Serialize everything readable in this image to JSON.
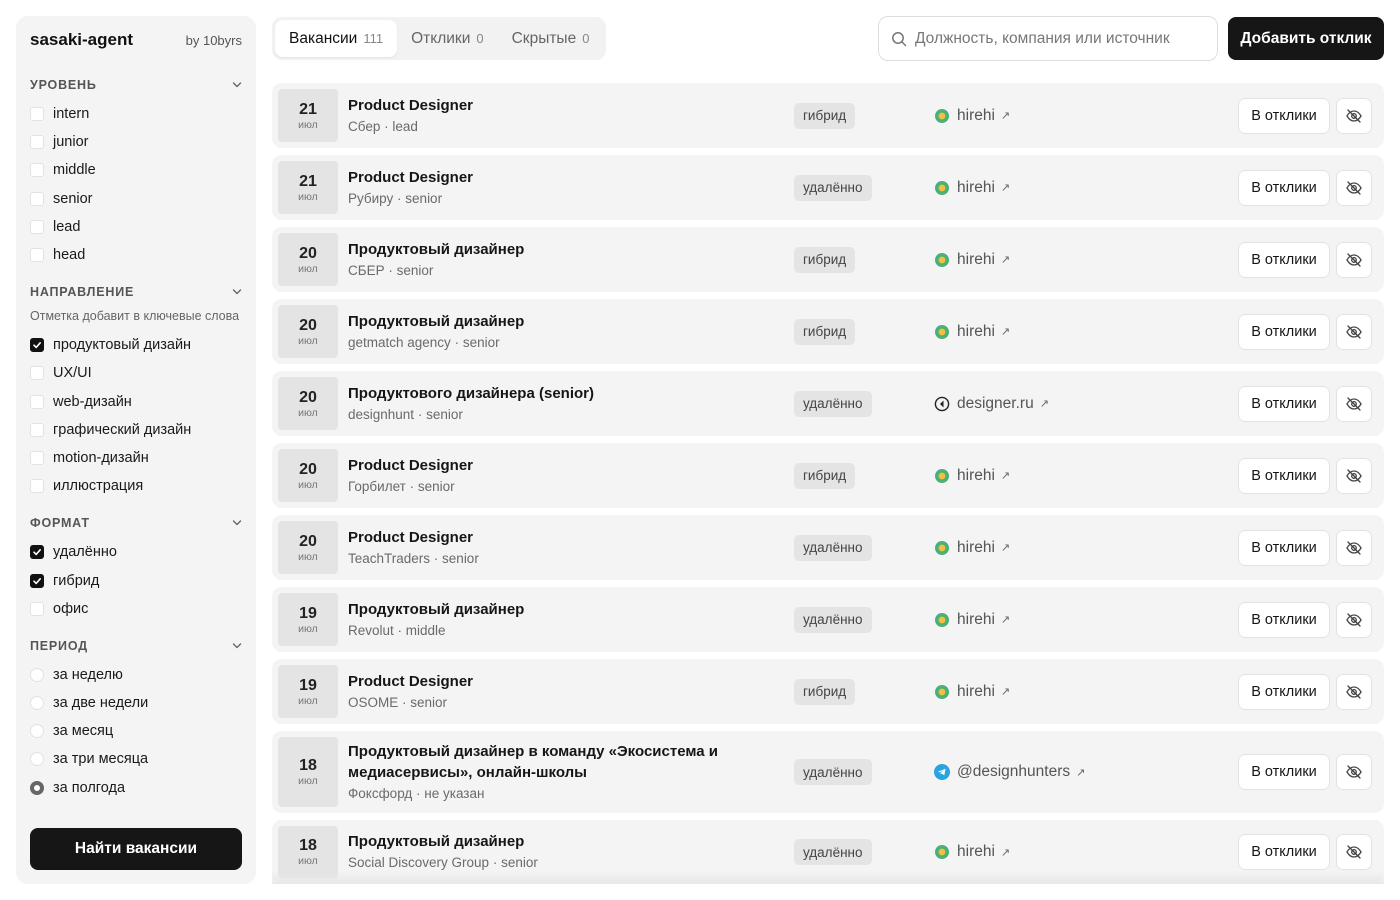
{
  "sidebar": {
    "brand": "sasaki-agent",
    "by": "by 10byrs",
    "level": {
      "title": "УРОВЕНЬ",
      "options": [
        {
          "label": "intern",
          "checked": false
        },
        {
          "label": "junior",
          "checked": false
        },
        {
          "label": "middle",
          "checked": false
        },
        {
          "label": "senior",
          "checked": false
        },
        {
          "label": "lead",
          "checked": false
        },
        {
          "label": "head",
          "checked": false
        }
      ]
    },
    "direction": {
      "title": "НАПРАВЛЕНИЕ",
      "hint": "Отметка добавит в ключевые слова",
      "options": [
        {
          "label": "продуктовый дизайн",
          "checked": true
        },
        {
          "label": "UX/UI",
          "checked": false
        },
        {
          "label": "web-дизайн",
          "checked": false
        },
        {
          "label": "графический дизайн",
          "checked": false
        },
        {
          "label": "motion-дизайн",
          "checked": false
        },
        {
          "label": "иллюстрация",
          "checked": false
        }
      ]
    },
    "format": {
      "title": "ФОРМАТ",
      "options": [
        {
          "label": "удалённо",
          "checked": true
        },
        {
          "label": "гибрид",
          "checked": true
        },
        {
          "label": "офис",
          "checked": false
        }
      ]
    },
    "period": {
      "title": "ПЕРИОД",
      "options": [
        {
          "label": "за неделю",
          "selected": false
        },
        {
          "label": "за две недели",
          "selected": false
        },
        {
          "label": "за месяц",
          "selected": false
        },
        {
          "label": "за три месяца",
          "selected": false
        },
        {
          "label": "за полгода",
          "selected": true
        }
      ]
    },
    "find_button": "Найти вакансии"
  },
  "tabs": [
    {
      "label": "Вакансии",
      "count": "111",
      "active": true
    },
    {
      "label": "Отклики",
      "count": "0",
      "active": false
    },
    {
      "label": "Скрытые",
      "count": "0",
      "active": false
    }
  ],
  "search": {
    "placeholder": "Должность, компания или источник",
    "value": ""
  },
  "add_button": "Добавить отклик",
  "respond_label": "В отклики",
  "vacancies": [
    {
      "day": "21",
      "month": "июл",
      "title": "Product Designer",
      "company": "Сбер",
      "level": "lead",
      "format": "гибрид",
      "source": "hirehi",
      "source_icon": "hirehi-icon"
    },
    {
      "day": "21",
      "month": "июл",
      "title": "Product Designer",
      "company": "Рубиру",
      "level": "senior",
      "format": "удалённо",
      "source": "hirehi",
      "source_icon": "hirehi-icon"
    },
    {
      "day": "20",
      "month": "июл",
      "title": "Продуктовый дизайнер",
      "company": "СБЕР",
      "level": "senior",
      "format": "гибрид",
      "source": "hirehi",
      "source_icon": "hirehi-icon"
    },
    {
      "day": "20",
      "month": "июл",
      "title": "Продуктовый дизайнер",
      "company": "getmatch agency",
      "level": "senior",
      "format": "гибрид",
      "source": "hirehi",
      "source_icon": "hirehi-icon"
    },
    {
      "day": "20",
      "month": "июл",
      "title": "Продуктового дизайнера (senior)",
      "company": "designhunt",
      "level": "senior",
      "format": "удалённо",
      "source": "designer.ru",
      "source_icon": "designer-ru-icon"
    },
    {
      "day": "20",
      "month": "июл",
      "title": "Product Designer",
      "company": "Горбилет",
      "level": "senior",
      "format": "гибрид",
      "source": "hirehi",
      "source_icon": "hirehi-icon"
    },
    {
      "day": "20",
      "month": "июл",
      "title": "Product Designer",
      "company": "TeachTraders",
      "level": "senior",
      "format": "удалённо",
      "source": "hirehi",
      "source_icon": "hirehi-icon"
    },
    {
      "day": "19",
      "month": "июл",
      "title": "Продуктовый дизайнер",
      "company": "Revolut",
      "level": "middle",
      "format": "удалённо",
      "source": "hirehi",
      "source_icon": "hirehi-icon"
    },
    {
      "day": "19",
      "month": "июл",
      "title": "Product Designer",
      "company": "OSOME",
      "level": "senior",
      "format": "гибрид",
      "source": "hirehi",
      "source_icon": "hirehi-icon"
    },
    {
      "day": "18",
      "month": "июл",
      "title": "Продуктовый дизайнер в команду «Экосистема и медиасервисы», онлайн-школы",
      "company": "Фоксфорд",
      "level": "не указан",
      "format": "удалённо",
      "source": "@designhunters",
      "source_icon": "telegram-icon"
    },
    {
      "day": "18",
      "month": "июл",
      "title": "Продуктовый дизайнер",
      "company": "Social Discovery Group",
      "level": "senior",
      "format": "удалённо",
      "source": "hirehi",
      "source_icon": "hirehi-icon"
    }
  ]
}
